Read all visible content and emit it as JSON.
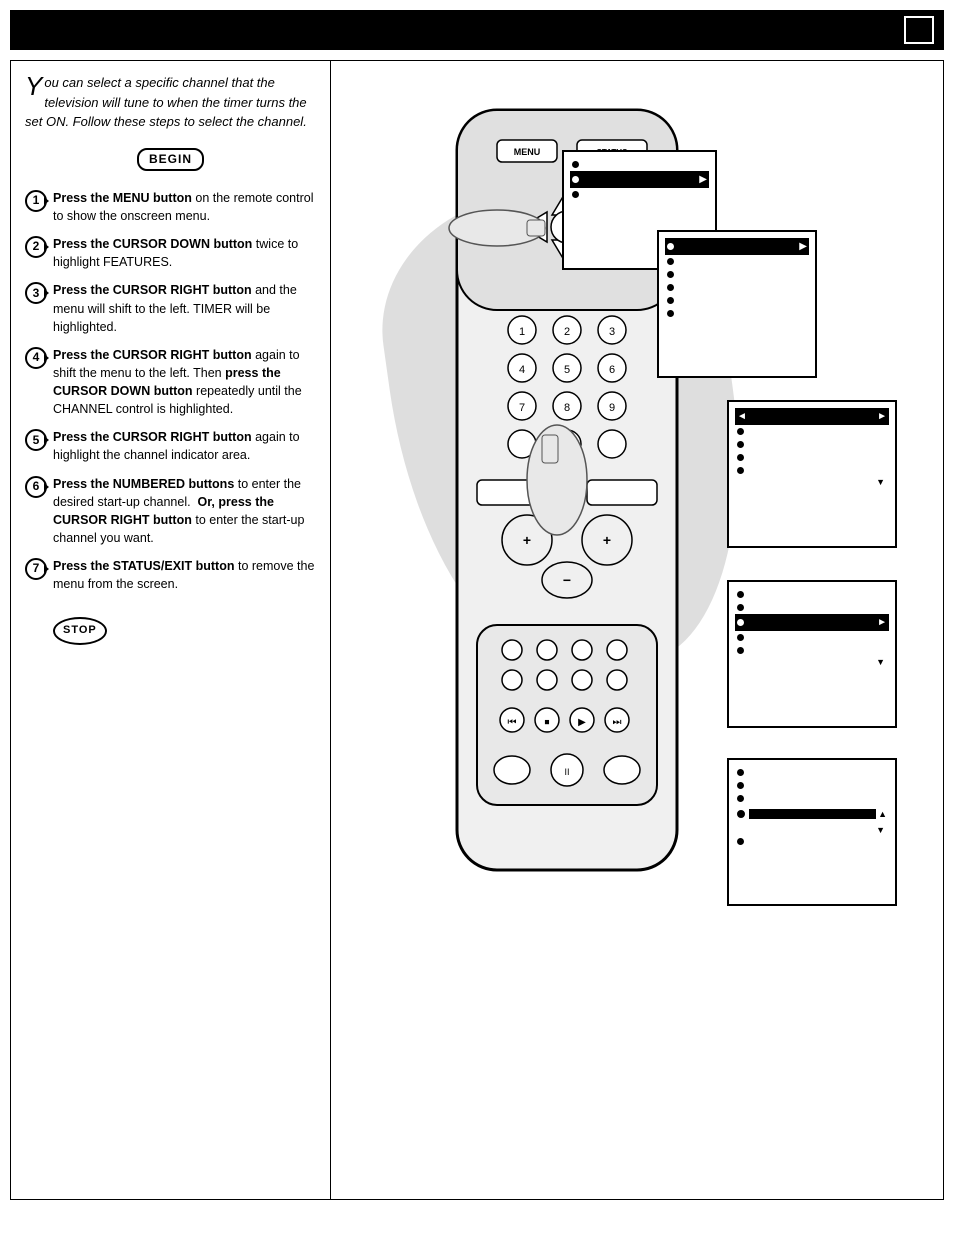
{
  "page": {
    "page_number": "",
    "header_title": ""
  },
  "intro": {
    "big_letter": "Y",
    "text": "ou can select a specific channel that the television will tune to when the timer turns the set ON. Follow these steps to select the channel."
  },
  "begin_label": "BEGIN",
  "stop_label": "STOP",
  "steps": [
    {
      "num": "1",
      "text_parts": [
        {
          "bold": true,
          "text": "Press the MENU button"
        },
        {
          "bold": false,
          "text": " on the remote control to show the onscreen menu."
        }
      ]
    },
    {
      "num": "2",
      "text_parts": [
        {
          "bold": true,
          "text": "Press the CURSOR DOWN button"
        },
        {
          "bold": false,
          "text": " twice to highlight FEATURES."
        }
      ]
    },
    {
      "num": "3",
      "text_parts": [
        {
          "bold": true,
          "text": "Press the CURSOR RIGHT button"
        },
        {
          "bold": false,
          "text": " and the menu will shift to the left. TIMER will be highlighted."
        }
      ]
    },
    {
      "num": "4",
      "text_parts": [
        {
          "bold": true,
          "text": "Press the CURSOR RIGHT button"
        },
        {
          "bold": false,
          "text": " again to shift the menu to the left. Then "
        },
        {
          "bold": true,
          "text": "press the CURSOR DOWN button"
        },
        {
          "bold": false,
          "text": " repeatedly until the CHANNEL control is highlighted."
        }
      ]
    },
    {
      "num": "5",
      "text_parts": [
        {
          "bold": true,
          "text": "Press the CURSOR RIGHT button"
        },
        {
          "bold": false,
          "text": " again to highlight the channel indicator area."
        }
      ]
    },
    {
      "num": "6",
      "text_parts": [
        {
          "bold": true,
          "text": "Press the NUMBERED buttons"
        },
        {
          "bold": false,
          "text": " to enter the desired start-up channel.  "
        },
        {
          "bold": true,
          "text": "Or, press the CURSOR RIGHT button"
        },
        {
          "bold": false,
          "text": " to enter the start-up channel you want."
        }
      ]
    },
    {
      "num": "7",
      "text_parts": [
        {
          "bold": true,
          "text": "Press the STATUS/EXIT button"
        },
        {
          "bold": false,
          "text": " to remove the menu from the screen."
        }
      ]
    }
  ],
  "screens": [
    {
      "id": "screen1",
      "items": [
        {
          "text": "",
          "selected": false,
          "has_bullet": true
        },
        {
          "text": "■■■■■■■■■",
          "selected": true,
          "has_bullet": true,
          "arrow_right": ""
        },
        {
          "text": "",
          "selected": false,
          "has_bullet": true
        }
      ]
    },
    {
      "id": "screen2",
      "items": [
        {
          "text": "■■■■■■",
          "selected": true,
          "has_bullet": true,
          "arrow_right": ""
        },
        {
          "text": "",
          "selected": false,
          "has_bullet": true
        },
        {
          "text": "",
          "selected": false,
          "has_bullet": true
        },
        {
          "text": "",
          "selected": false,
          "has_bullet": true
        },
        {
          "text": "",
          "selected": false,
          "has_bullet": true
        },
        {
          "text": "",
          "selected": false,
          "has_bullet": true
        }
      ]
    },
    {
      "id": "screen3",
      "items": [
        {
          "text": "◄ ■■■■■■■■■ ►",
          "selected": true,
          "has_bullet": true
        },
        {
          "text": "",
          "selected": false,
          "has_bullet": true
        },
        {
          "text": "",
          "selected": false,
          "has_bullet": true
        },
        {
          "text": "",
          "selected": false,
          "has_bullet": true
        },
        {
          "text": "",
          "selected": false,
          "has_bullet": true
        }
      ]
    },
    {
      "id": "screen4",
      "items": [
        {
          "text": "",
          "selected": false,
          "has_bullet": true
        },
        {
          "text": "",
          "selected": false,
          "has_bullet": true
        },
        {
          "text": "■■■■■■■■ ►",
          "selected": true,
          "has_bullet": true
        },
        {
          "text": "",
          "selected": false,
          "has_bullet": true
        },
        {
          "text": "",
          "selected": false,
          "has_bullet": true
        }
      ]
    },
    {
      "id": "screen5",
      "items": [
        {
          "text": "",
          "selected": false,
          "has_bullet": true
        },
        {
          "text": "",
          "selected": false,
          "has_bullet": true
        },
        {
          "text": "",
          "selected": false,
          "has_bullet": true
        },
        {
          "text": "● ■■■■■■■■■ ▼",
          "selected": false,
          "has_bullet": false
        },
        {
          "text": "",
          "selected": false,
          "has_bullet": true
        }
      ]
    }
  ]
}
